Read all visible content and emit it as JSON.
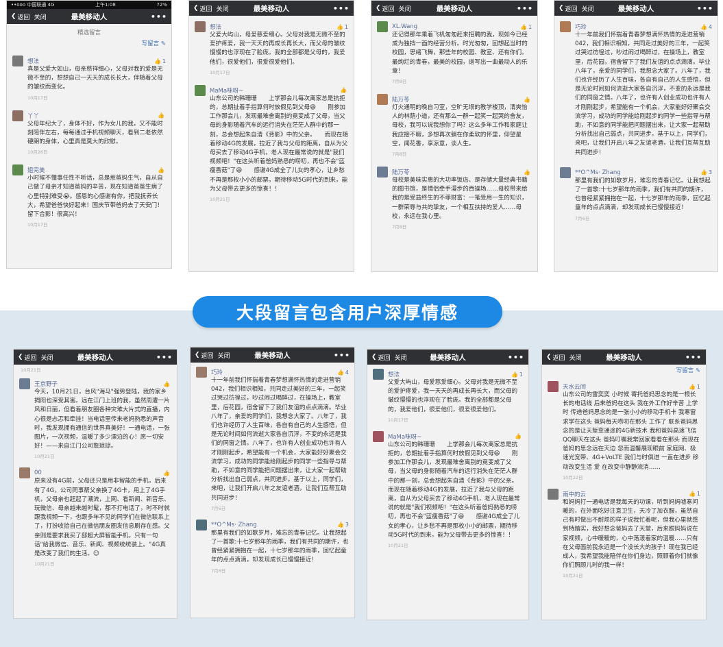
{
  "banner": "大段留言包含用户深厚情感",
  "common": {
    "back": "返回",
    "close": "关闭",
    "title": "最美移动人",
    "more": "•••",
    "thumb": "👍"
  },
  "status": {
    "carrier": "••ooo 中国联通 4G",
    "time": "上午1:08",
    "battery": "72%"
  },
  "p1": {
    "sub": "精选留言",
    "write": "写留言",
    "comments": [
      {
        "name": "想法",
        "likes": "1",
        "text": "真是父爱大如山，母亲慈祥细心，父母对我的爱是无微不至的，想想自己一天天的成长长大，伴随着父母的皱纹而变化。",
        "date": "10月17日"
      },
      {
        "name": "丫丫",
        "likes": "",
        "text": "父母年纪大了，身体不好，作为女儿的我，又不能时刻陪伴左右，每每通过手机视频聊天，看到二老依然硬朗的身体，心里真是莫大的欣慰。",
        "date": "10月26日"
      },
      {
        "name": "姐完美",
        "likes": "",
        "text": "小时候不懂事任性不听话，总是惹爸妈生气，自从自己做了母亲才知道爸妈的辛苦，现在知道爸爸生病了心里特别难受😭。感恩的心感谢有你，把我抚养长大，希望爸爸快好起来！国庆节带爸妈去了天安门！留下合影！很高兴！",
        "date": "10月17日"
      }
    ]
  },
  "p2": {
    "comments": [
      {
        "name": "想法",
        "likes": "1",
        "text": "父爱大屿山，母爱慈爱细心。父母对我是无微不至的爱护疼爱，我一天天的再成长再长大，而父母的皱纹慢慢的也浮现在了脸庞。我的全部都是父母的，我爱他们，很爱他们，很爱很爱他们。",
        "date": "10月17日"
      },
      {
        "name": "MaMa咪呀~",
        "likes": "",
        "text": "山东公司的韩珊珊　　上学那会儿每次离家总是抗拒的，总期扯着手指算何时放假见到父母😆　　刚参加工作那会儿，发现最难舍离别的竟变成了父母，当父母的身影随着汽车的远行消失在茫茫人群中的那一刻，总会想起朱自清《背影》中的父亲。　　而现在随着移动4G的发展，拉近了我与父母的距离，自从为父母买去了移动4G手机，老人现在最常说的就是\"我们视频吧！\"在这头听着爸妈熟悉的唠叨，再也不会\"蓝瘦香菇\"了😆　　感谢4G成全了儿女的孝心，让乡愁不再是那枚小小的邮票，期待移动5G时代的到来，能为父母带去更多的惊喜！！",
        "date": "10月21日"
      }
    ]
  },
  "p3": {
    "comments": [
      {
        "name": "XL.Wang",
        "likes": "1",
        "text": "还记得那年乘着飞机匆匆赶来招聘的我，现如今已经成为独挡一面的经营分析。时光匆匆，回想起当时的校园，思绪飞舞，那些年的校园、教室、还有你们。最绚烂的青春，最美的校园，谱写出一曲最动人的乐章！",
        "date": "7月8日"
      },
      {
        "name": "陆万苓",
        "likes": "",
        "text": "灯火通明的晚自习室，空旷无垠的教学楼顶，清爽怡人的林荫小道，还有那么一群一起笑一起哭的舍友，母校，我可以说我想你了吗？这么多年工作和家庭让我应接不暇，多想再次躺在你柔软的怀里，仰望星空，闻花香，享凉意，谈人生。",
        "date": "7月8日"
      },
      {
        "name": "陆万苓",
        "likes": "",
        "text": "母校是美味实惠的大功率饭店、是存储大量经典书籍的图书馆，是情侣牵手漫步的西操场……母校带来给我的是受益终生的不菲财富：一笔受用一生的知识，一群荣辱与共的挚友，一个相互扶持的爱人……母校，永远在我心里。",
        "date": "7月8日"
      }
    ]
  },
  "p4": {
    "comments": [
      {
        "name": "巧玲",
        "likes": "4",
        "text": "十一年前我们怀揣着青春梦想满怀热情的走进营销042，我们相识相知，共同走过美好的三年，一起笑过哭过彷徨过，吵过闹过喝醉过，在操场上，教室里，后花园，宿舍留下了我们友谊的点点滴滴。毕业八年了，亲爱的同学们，我想念大家了。八年了，我们也许经历了人生百味，各自有自己的人生感悟，但是无论时间如何流逝大家各自沉浮，不变的永远是我们的同窗之情。八年了，也许有人创业成功也许有人才刚刚起步，希望能有一个机会，大家能好好聚会交流学习，成功的同学能给刚起步的同学一些指导与帮助，不如意的同学能把问题摆出来，让大家一起帮助分析找出自己弱点，共同进步。基于以上，同学们，来吧，让我们开启八年之友谊老酒，让我们互帮互助共同进步！",
        "date": ""
      },
      {
        "name": "**O^Ms· Zhang",
        "likes": "3",
        "text": "那里有我们的如歌岁月，难忘的青春记忆。让我想起了一首歌:十七岁那年的雨季，我们有共同的期许，也曾经紧紧拥抱在一起，十七岁那年的雨季，回忆起童年的点点滴滴，却发现成长已慢慢接近！",
        "date": "7月6日"
      }
    ]
  },
  "p5": {
    "top_date": "10月21日",
    "comments": [
      {
        "name": "王京野子",
        "likes": "",
        "text": "今天，10月21日，台风\"海马\"强势登陆，我的家乡揭阳也深受其害。远在江门上班的我，虽然周遭一片风和日丽，但看着朋友圈各种灾难大片式的直播，内心很是忐忑和牵挂！当电话里传来老妈熟悉的声音时，我发现拥有通信的世界真美好！一通电话，一张图片，一次视频，温暖了多少漂泊的心！愿一切安好！——来自江门公司詹琼琼。",
        "date": "10月21日"
      },
      {
        "name": "00",
        "likes": "",
        "text": "原来没有4G前，父母还只是用非智能的手机，后来有了4G，公司同事帮父亲换了4G卡，用上了4G手机，父母亲也赶起了潮流，上网、看新闻、新音乐、玩微信、母亲越来越时髦，都不打电话了，时不时就跟我视频一下，也跟多年不见的同学们在微信联系上了，打扮收拾自己在微信朋友圈发信息刷存在感。父亲则是要求我买了部超大屏智能手机，只有一句话\"给我微信、音乐、新闻、视频统统装上。\"4G真是改变了我们的生活。😊",
        "date": "10月21日"
      }
    ]
  },
  "p6": {
    "comments": [
      {
        "name": "巧玲",
        "likes": "4",
        "text": "十一年前我们怀揣着青春梦想满怀热情的走进营销042，我们相识相知，共同走过美好的三年，一起笑过哭过彷徨过，吵过闹过喝醉过，在操场上，教室里，后花园，宿舍留下了我们友谊的点点滴滴。毕业八年了，亲爱的同学们，我想念大家了。八年了，我们也许经历了人生百味，各自有自己的人生感悟，但是无论时间如何流逝大家各自沉浮，不变的永远是我们的同窗之情。八年了，也许有人创业成功也许有人才刚刚起步，希望能有一个机会，大家能好好聚会交流学习，成功的同学能给刚起步的同学一些指导与帮助，不如意的同学能把问题摆出来，让大家一起帮助分析找出自己弱点，共同进步。基于以上，同学们，来吧，让我们开启八年之友谊老酒，让我们互帮互助共同进步！",
        "date": "7月6日"
      },
      {
        "name": "**O^Ms· Zhang",
        "likes": "3",
        "text": "那里有我们的如歌岁月，难忘的青春记忆。让我想起了一首歌:十七岁那年的雨季，我们有共同的期许，也曾经紧紧拥抱在一起，十七岁那年的雨季，回忆起童年的点点滴滴，却发现成长已慢慢接近！",
        "date": "7月6日"
      }
    ]
  },
  "p7": {
    "comments": [
      {
        "name": "想法",
        "likes": "1",
        "text": "父爱大屿山，母爱慈爱细心。父母对我是无微不至的爱护疼爱，我一天天的再成长再长大，而父母的皱纹慢慢的也浮现在了脸庞。我的全部都是父母的，我爱他们，很爱他们，很爱很爱他们。",
        "date": "10月17日"
      },
      {
        "name": "MaMa咪呀~",
        "likes": "",
        "text": "山东公司的韩珊珊　　上学那会儿每次离家总是抗拒的，总期扯着手指算何时放假见到父母😆　　刚参加工作那会儿，发现最难舍离别的竟变成了父母，当父母的身影随着汽车的远行消失在茫茫人群中的那一刻，总会想起朱自清《背影》中的父亲。　　而现在随着移动4G的发展，拉近了我与父母的距离，自从为父母买去了移动4G手机，老人现在最常说的就是\"我们视频吧！\"在这头听着爸妈熟悉的唠叨，再也不会\"蓝瘦香菇\"了😆　　感谢4G成全了儿女的孝心，让乡愁不再是那枚小小的邮票，期待移动5G时代的到来，能为父母带去更多的惊喜！！",
        "date": "10月21日"
      }
    ]
  },
  "p8": {
    "write": "写留言",
    "comments": [
      {
        "name": "天水云间",
        "likes": "1",
        "text": "山东公司的雷奕奕 小时候 寄托爸妈思念的是一根长长的电话线 后来爸妈在这头 我在外工作好辛苦 上学时 传递爸妈思念的是一张小小的移动手机卡 我寒窗求学在这头 爸妈每天唠叨在那头 工作了 联系爸妈思念的是让天堑变通途的4G新技术 我和爸妈高速飞信QQ聊天在这头 爸妈叮嘱我常回家看看在那头 而现在 爸妈的思念远在天边 忽而温馨展现眼前 家庭网、极速光宽带、4G+VoLTE 我们与时俱进 一直在进步 移动改变生活 爱 在改变中静静流淌……",
        "date": "10月22日"
      },
      {
        "name": "雨中的云",
        "likes": "1",
        "text": "和妈妈打一通电话是我每天的功课，听到妈妈嘘寒问暖的，在外面吃好注意卫生，天冷了加衣服，虽然自己有时做出不耐烦的样子说我忙着呢，但我心里就感到特踏实，我好想念爸妈去了天堂，后来跟妈妈说在家视频，心中暖暖的，心中荡漾着家的温暖……只有在父母面前我永远是一个没长大的孩子！现在我已经成人，我希望我能陪伴在你们身边，照顾着你们就像你们照顾儿时的我一样！",
        "date": "10月21日"
      }
    ]
  }
}
